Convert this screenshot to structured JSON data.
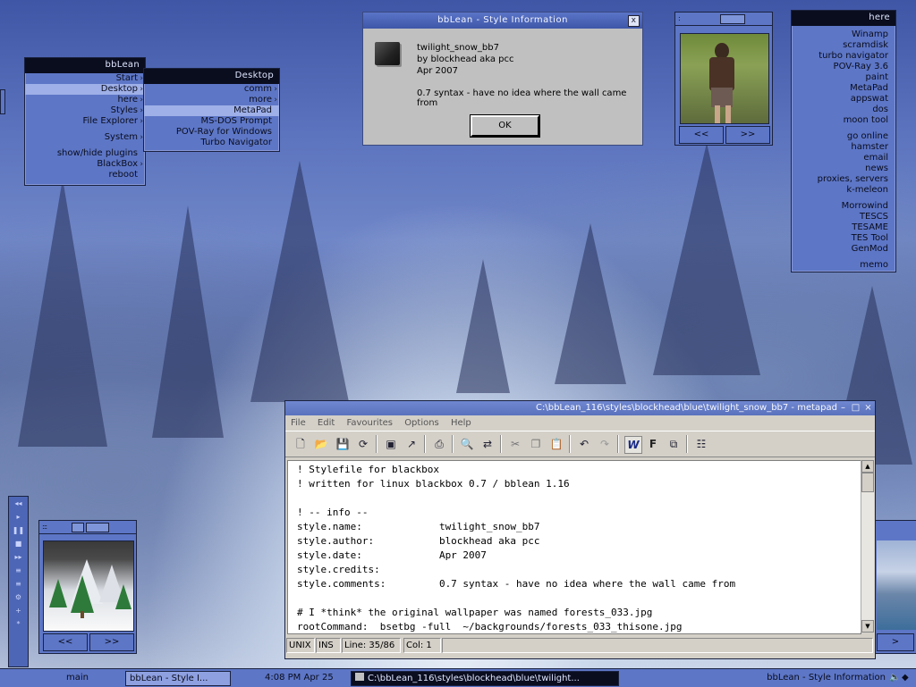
{
  "bblean_menu": {
    "title": "bbLean",
    "items": [
      "Start",
      "Desktop",
      "here",
      "Styles",
      "File Explorer",
      "System",
      "show/hide plugins",
      "BlackBox",
      "reboot"
    ]
  },
  "desktop_menu": {
    "title": "Desktop",
    "items": [
      "comm",
      "more",
      "MetaPad",
      "MS-DOS Prompt",
      "POV-Ray for Windows",
      "Turbo Navigator"
    ]
  },
  "dialog": {
    "title": "bbLean - Style Information",
    "close_label": "x",
    "style_name": "twilight_snow_bb7",
    "author_line": "by blockhead aka pcc",
    "date": "Apr 2007",
    "comment": "0.7 syntax - have no idea where the wall came from",
    "ok_label": "OK"
  },
  "viewer_top": {
    "prev_label": "<<",
    "next_label": ">>",
    "dots": ":"
  },
  "viewer_bottom": {
    "prev_label": "<<",
    "next_label": ">>",
    "dots": ":::"
  },
  "viewer_right": {
    "next_label": ">"
  },
  "here_menu": {
    "title": "here",
    "groups": [
      [
        "Winamp",
        "scramdisk",
        "turbo navigator",
        "POV-Ray 3.6",
        "paint",
        "MetaPad",
        "appswat",
        "dos",
        "moon tool"
      ],
      [
        "go online",
        "hamster",
        "email",
        "news",
        "proxies, servers",
        "k-meleon"
      ],
      [
        "Morrowind",
        "TESCS",
        "TESAME",
        "TES Tool",
        "GenMod"
      ],
      [
        "memo"
      ]
    ]
  },
  "metapad": {
    "title": "C:\\bbLean_116\\styles\\blockhead\\blue\\twilight_snow_bb7 - metapad",
    "menus": [
      "File",
      "Edit",
      "Favourites",
      "Options",
      "Help"
    ],
    "lines": [
      "! Stylefile for blackbox",
      "! written for linux blackbox 0.7 / bblean 1.16",
      "",
      "! -- info --",
      "style.name:             twilight_snow_bb7",
      "style.author:           blockhead aka pcc",
      "style.date:             Apr 2007",
      "style.credits:",
      "style.comments:         0.7 syntax - have no idea where the wall came from",
      "",
      "# I *think* the original wallpaper was named forests_033.jpg",
      "rootCommand:  bsetbg -full  ~/backgrounds/forests_033_thisone.jpg"
    ],
    "status": {
      "format": "UNIX",
      "mode": "INS",
      "line": "Line: 35/86",
      "col": "Col: 1"
    }
  },
  "taskbar": {
    "workspace": "main",
    "task1": "bbLean - Style I...",
    "clock": "4:08 PM  Apr 25",
    "task2": "C:\\bbLean_116\\styles\\blockhead\\blue\\twilight...",
    "task3": "bbLean - Style Information"
  },
  "colors": {
    "accent": "#5d76c6",
    "dark": "#0a0d1e",
    "highlight": "#9fb0e8"
  }
}
